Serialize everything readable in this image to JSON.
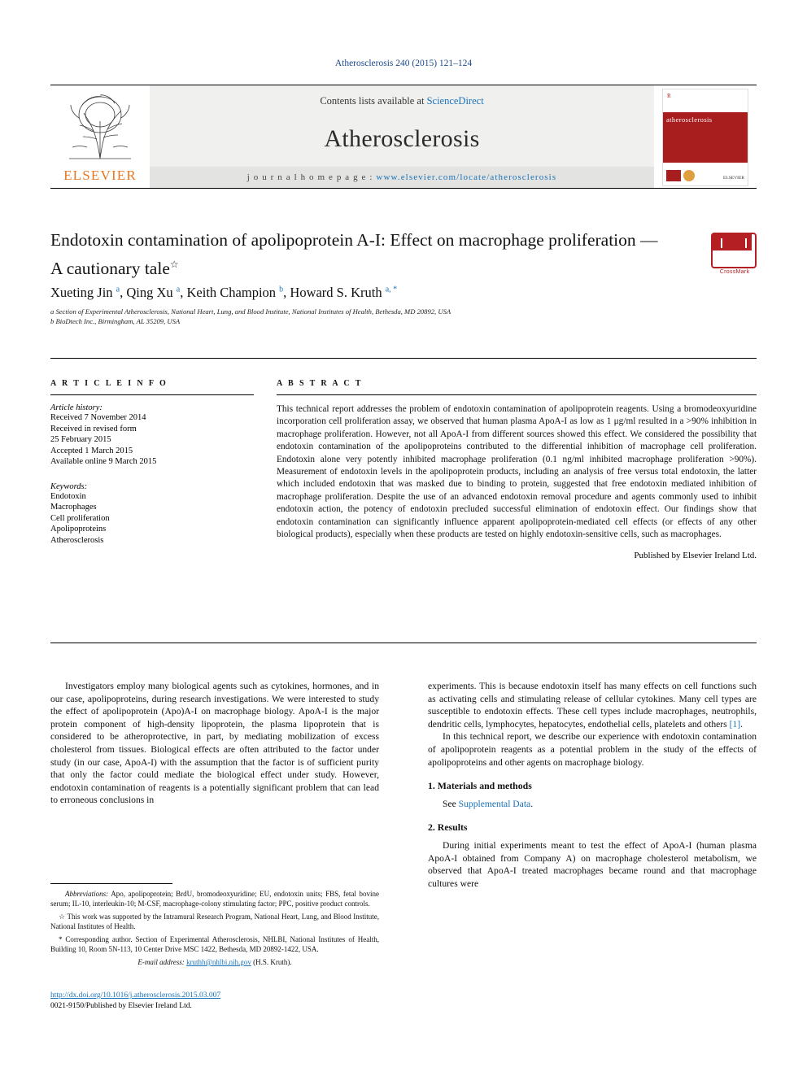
{
  "journal_ref": "Atherosclerosis 240 (2015) 121–124",
  "masthead": {
    "publisher": "ELSEVIER",
    "contents_prefix": "Contents lists available at",
    "contents_link": "ScienceDirect",
    "journal_title": "Atherosclerosis",
    "homepage_label": "j o u r n a l   h o m e p a g e :",
    "homepage_url": "www.elsevier.com/locate/atherosclerosis",
    "cover_title": "atherosclerosis",
    "cover_badge": "R",
    "cover_publisher": "ELSEVIER"
  },
  "article": {
    "title": "Endotoxin contamination of apolipoprotein A-I: Effect on macrophage proliferation — A cautionary tale",
    "title_footnote_mark": "☆",
    "crossmark_label": "CrossMark",
    "authors": "Xueting Jin a, Qing Xu a, Keith Champion b, Howard S. Kruth a, *",
    "affiliations": [
      "a Section of Experimental Atherosclerosis, National Heart, Lung, and Blood Institute, National Institutes of Health, Bethesda, MD 20892, USA",
      "b BioDtech Inc., Birmingham, AL 35209, USA"
    ]
  },
  "article_info": {
    "heading": "A R T I C L E    I N F O",
    "history_title": "Article history:",
    "history": [
      "Received 7 November 2014",
      "Received in revised form",
      "25 February 2015",
      "Accepted 1 March 2015",
      "Available online 9 March 2015"
    ],
    "keywords_title": "Keywords:",
    "keywords": [
      "Endotoxin",
      "Macrophages",
      "Cell proliferation",
      "Apolipoproteins",
      "Atherosclerosis"
    ]
  },
  "abstract": {
    "heading": "A B S T R A C T",
    "text": "This technical report addresses the problem of endotoxin contamination of apolipoprotein reagents. Using a bromodeoxyuridine incorporation cell proliferation assay, we observed that human plasma ApoA-I as low as 1 μg/ml resulted in a >90% inhibition in macrophage proliferation. However, not all ApoA-I from different sources showed this effect. We considered the possibility that endotoxin contamination of the apolipoproteins contributed to the differential inhibition of macrophage cell proliferation. Endotoxin alone very potently inhibited macrophage proliferation (0.1 ng/ml inhibited macrophage proliferation >90%). Measurement of endotoxin levels in the apolipoprotein products, including an analysis of free versus total endotoxin, the latter which included endotoxin that was masked due to binding to protein, suggested that free endotoxin mediated inhibition of macrophage proliferation. Despite the use of an advanced endotoxin removal procedure and agents commonly used to inhibit endotoxin action, the potency of endotoxin precluded successful elimination of endotoxin effect. Our findings show that endotoxin contamination can significantly influence apparent apolipoprotein-mediated cell effects (or effects of any other biological products), especially when these products are tested on highly endotoxin-sensitive cells, such as macrophages.",
    "published_by": "Published by Elsevier Ireland Ltd."
  },
  "body": {
    "left_paragraph": "Investigators employ many biological agents such as cytokines, hormones, and in our case, apolipoproteins, during research investigations. We were interested to study the effect of apolipoprotein (Apo)A-I on macrophage biology. ApoA-I is the major protein component of high-density lipoprotein, the plasma lipoprotein that is considered to be atheroprotective, in part, by mediating mobilization of excess cholesterol from tissues. Biological effects are often attributed to the factor under study (in our case, ApoA-I) with the assumption that the factor is of sufficient purity that only the factor could mediate the biological effect under study. However, endotoxin contamination of reagents is a potentially significant problem that can lead to erroneous conclusions in",
    "right_paragraph_1": "experiments. This is because endotoxin itself has many effects on cell functions such as activating cells and stimulating release of cellular cytokines. Many cell types are susceptible to endotoxin effects. These cell types include macrophages, neutrophils, dendritic cells, lymphocytes, hepatocytes, endothelial cells, platelets and others",
    "right_paragraph_1_ref": "[1]",
    "right_paragraph_2": "In this technical report, we describe our experience with endotoxin contamination of apolipoprotein reagents as a potential problem in the study of the effects of apolipoproteins and other agents on macrophage biology.",
    "section_1_title": "1.  Materials and methods",
    "section_1_text_prefix": "See",
    "section_1_link": "Supplemental Data",
    "section_2_title": "2.  Results",
    "section_2_text": "During initial experiments meant to test the effect of ApoA-I (human plasma ApoA-I obtained from Company A) on macrophage cholesterol metabolism, we observed that ApoA-I treated macrophages became round and that macrophage cultures were"
  },
  "footnotes": {
    "abbreviations_label": "Abbreviations:",
    "abbreviations_text": "Apo, apolipoprotein; BrdU, bromodeoxyuridine; EU, endotoxin units; FBS, fetal bovine serum; IL-10, interleukin-10; M-CSF, macrophage-colony stimulating factor; PPC, positive product controls.",
    "star_note": "☆ This work was supported by the Intramural Research Program, National Heart, Lung, and Blood Institute, National Institutes of Health.",
    "corresponding": "* Corresponding author. Section of Experimental Atherosclerosis, NHLBI, National Institutes of Health, Building 10, Room 5N-113, 10 Center Drive MSC 1422, Bethesda, MD 20892-1422, USA.",
    "email_label": "E-mail address:",
    "email": "kruthh@nhlbi.nih.gov",
    "email_suffix": "(H.S. Kruth)."
  },
  "doi": {
    "url": "http://dx.doi.org/10.1016/j.atherosclerosis.2015.03.007",
    "issn_line": "0021-9150/Published by Elsevier Ireland Ltd."
  }
}
